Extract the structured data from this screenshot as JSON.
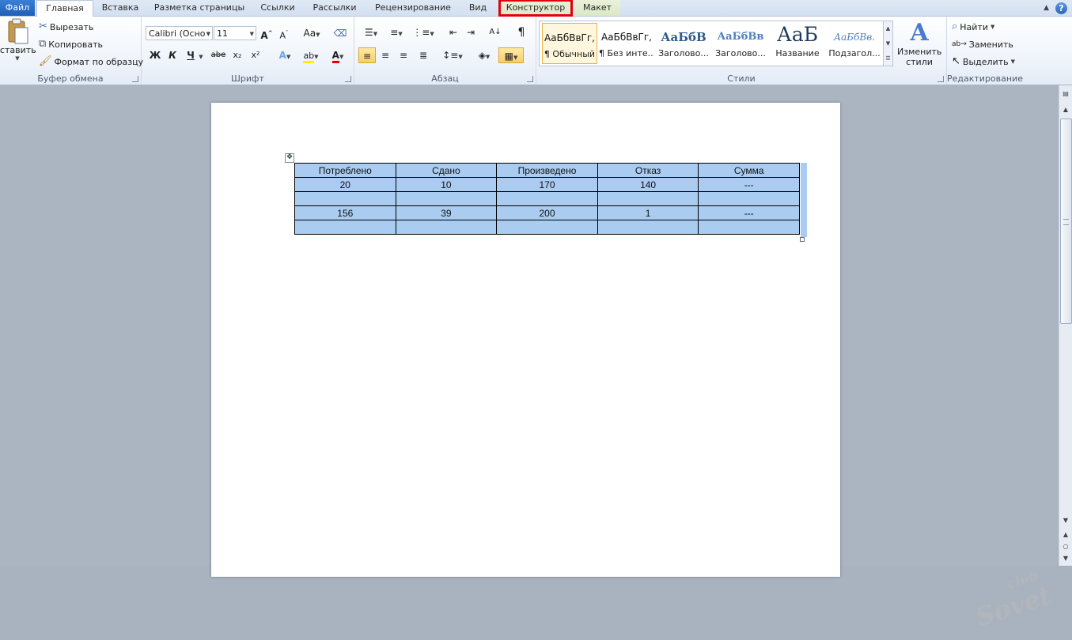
{
  "tabs": [
    {
      "label": "Файл"
    },
    {
      "label": "Главная"
    },
    {
      "label": "Вставка"
    },
    {
      "label": "Разметка страницы"
    },
    {
      "label": "Ссылки"
    },
    {
      "label": "Рассылки"
    },
    {
      "label": "Рецензирование"
    },
    {
      "label": "Вид"
    },
    {
      "label": "Конструктор"
    },
    {
      "label": "Макет"
    }
  ],
  "clipboard": {
    "paste_label": "Вставить",
    "cut": "Вырезать",
    "copy": "Копировать",
    "format_painter": "Формат по образцу",
    "group_label": "Буфер обмена"
  },
  "font": {
    "font_name": "Calibri (Осно",
    "font_size": "11",
    "bold": "Ж",
    "italic": "К",
    "underline": "Ч",
    "strike": "abe",
    "subscript": "x₂",
    "superscript": "x²",
    "group_label": "Шрифт"
  },
  "paragraph": {
    "group_label": "Абзац"
  },
  "styles": {
    "items": [
      {
        "sample": "АаБбВвГг,",
        "name": "¶ Обычный"
      },
      {
        "sample": "АаБбВвГг,",
        "name": "¶ Без инте..."
      },
      {
        "sample": "АаБбВ",
        "name": "Заголово..."
      },
      {
        "sample": "АаБбВв",
        "name": "Заголово..."
      },
      {
        "sample": "АаБ",
        "name": "Название"
      },
      {
        "sample": "АаБбВв.",
        "name": "Подзагол..."
      }
    ],
    "change_styles": "Изменить стили",
    "group_label": "Стили"
  },
  "editing": {
    "find": "Найти",
    "replace": "Заменить",
    "select": "Выделить",
    "group_label": "Редактирование"
  },
  "table": {
    "rows": [
      [
        "Потреблено",
        "Сдано",
        "Произведено",
        "Отказ",
        "Сумма"
      ],
      [
        "20",
        "10",
        "170",
        "140",
        "---"
      ],
      [
        "",
        "",
        "",
        "",
        ""
      ],
      [
        "156",
        "39",
        "200",
        "1",
        "---"
      ],
      [
        "",
        "",
        "",
        "",
        ""
      ]
    ]
  },
  "watermark": "club Sovet",
  "colors": {
    "highlight_box": "#e3000f",
    "selection": "#a9ccf0",
    "file_tab": "#2a6cc7"
  }
}
